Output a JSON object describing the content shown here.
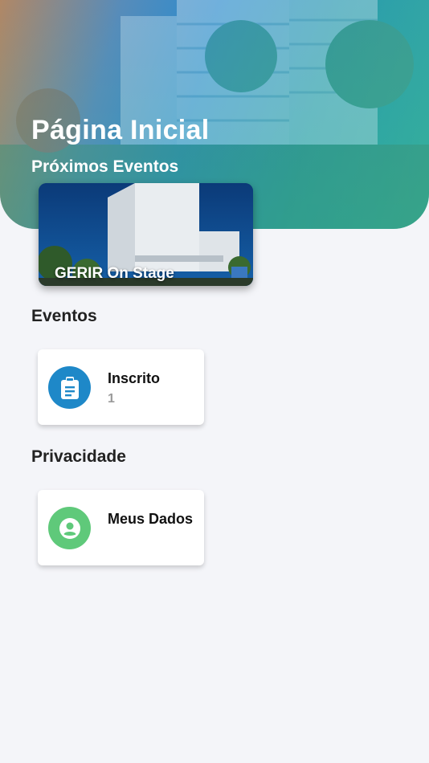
{
  "header": {
    "title": "Página Inicial",
    "upcoming_label": "Próximos Eventos"
  },
  "upcoming_events": [
    {
      "name": "GERIR On Stage"
    }
  ],
  "sections": {
    "events": {
      "title": "Eventos",
      "tile": {
        "label": "Inscrito",
        "count": "1",
        "icon": "clipboard-icon",
        "color": "#1e88c8"
      }
    },
    "privacy": {
      "title": "Privacidade",
      "tile": {
        "label": "Meus Dados",
        "icon": "account-circle-icon",
        "color": "#5fc97a"
      }
    }
  }
}
